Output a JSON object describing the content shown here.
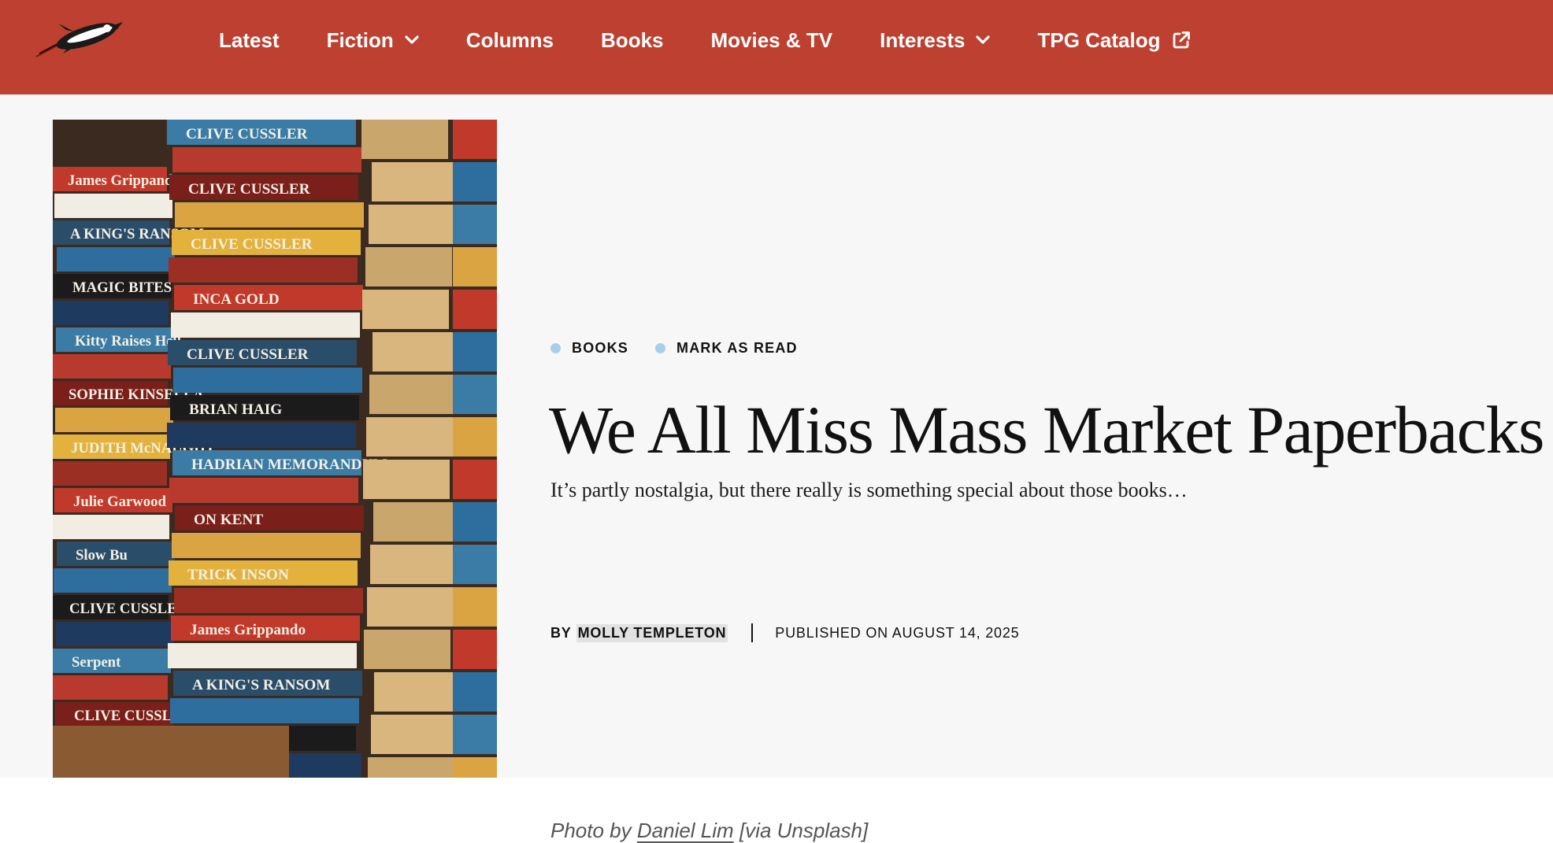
{
  "nav": {
    "logo_icon": "rocket-logo-icon",
    "items": [
      {
        "label": "Latest",
        "icon": null
      },
      {
        "label": "Fiction",
        "icon": "chevron-down-icon"
      },
      {
        "label": "Columns",
        "icon": null
      },
      {
        "label": "Books",
        "icon": null
      },
      {
        "label": "Movies & TV",
        "icon": null
      },
      {
        "label": "Interests",
        "icon": "chevron-down-icon"
      },
      {
        "label": "TPG Catalog",
        "icon": "external-link-icon"
      }
    ]
  },
  "article": {
    "tags": [
      "BOOKS",
      "MARK AS READ"
    ],
    "title": "We All Miss Mass Market Paperbacks",
    "dek": "It’s partly nostalgia, but there really is something special about those books…",
    "byline_prefix": "BY",
    "author": "MOLLY TEMPLETON",
    "published": "PUBLISHED ON AUGUST 14, 2025"
  },
  "photo": {
    "caption_prefix": "Photo by",
    "credit_name": "Daniel Lim",
    "caption_suffix": "[via Unsplash]",
    "spine_texts": [
      "James Grippando",
      "A KING'S RANSOM",
      "MAGIC BITES",
      "Kitty Raises Hell",
      "SOPHIE KINSELLA",
      "JUDITH McNAUGHT",
      "Julie Garwood",
      "Slow Bu",
      "CLIVE CUSSLER",
      "Serpent",
      "CLIVE CUSSLER",
      "CLIVE CUSSLER",
      "CLIVE CUSSLER",
      "CLIVE CUSSLER",
      "INCA GOLD",
      "CLIVE CUSSLER",
      "BRIAN HAIG",
      "HADRIAN MEMORANDUM",
      "ON KENT",
      "TRICK INSON"
    ]
  },
  "colors": {
    "nav_bg": "#bd4030",
    "tag_dot": "#a9cfe8",
    "hero_bg": "#f7f7f7"
  }
}
